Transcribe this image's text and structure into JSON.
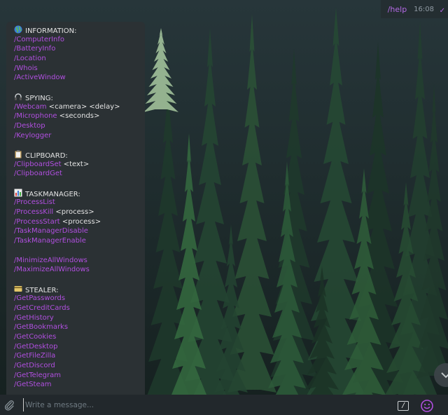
{
  "outgoing": {
    "text": "/help",
    "time": "16:08",
    "check": "✓"
  },
  "bubble": {
    "lines": [
      {
        "t": "h",
        "emoji": "globe-icon",
        "text": "INFORMATION:"
      },
      {
        "t": "c",
        "cmd": "/ComputerInfo",
        "arg": ""
      },
      {
        "t": "c",
        "cmd": "/BatteryInfo",
        "arg": ""
      },
      {
        "t": "c",
        "cmd": "/Location",
        "arg": ""
      },
      {
        "t": "c",
        "cmd": "/Whois",
        "arg": ""
      },
      {
        "t": "c",
        "cmd": "/ActiveWindow",
        "arg": ""
      },
      {
        "t": "g"
      },
      {
        "t": "h",
        "emoji": "headphones-icon",
        "text": "SPYING:"
      },
      {
        "t": "c",
        "cmd": "/Webcam",
        "arg": " <camera> <delay>"
      },
      {
        "t": "c",
        "cmd": "/Microphone",
        "arg": " <seconds>"
      },
      {
        "t": "c",
        "cmd": "/Desktop",
        "arg": ""
      },
      {
        "t": "c",
        "cmd": "/Keylogger",
        "arg": ""
      },
      {
        "t": "g"
      },
      {
        "t": "h",
        "emoji": "clipboard-icon",
        "text": "CLIPBOARD:"
      },
      {
        "t": "c",
        "cmd": "/ClipboardSet",
        "arg": " <text>"
      },
      {
        "t": "c",
        "cmd": "/ClipboardGet",
        "arg": ""
      },
      {
        "t": "g"
      },
      {
        "t": "h",
        "emoji": "bar-chart-icon",
        "text": "TASKMANAGER:"
      },
      {
        "t": "c",
        "cmd": "/ProcessList",
        "arg": ""
      },
      {
        "t": "c",
        "cmd": "/ProcessKill",
        "arg": " <process>"
      },
      {
        "t": "c",
        "cmd": "/ProcessStart",
        "arg": " <process>"
      },
      {
        "t": "c",
        "cmd": "/TaskManagerDisable",
        "arg": ""
      },
      {
        "t": "c",
        "cmd": "/TaskManagerEnable",
        "arg": ""
      },
      {
        "t": "g"
      },
      {
        "t": "c",
        "cmd": "/MinimizeAllWindows",
        "arg": ""
      },
      {
        "t": "c",
        "cmd": "/MaximizeAllWindows",
        "arg": ""
      },
      {
        "t": "g"
      },
      {
        "t": "h",
        "emoji": "credit-card-icon",
        "text": "STEALER:"
      },
      {
        "t": "c",
        "cmd": "/GetPasswords",
        "arg": ""
      },
      {
        "t": "c",
        "cmd": "/GetCreditCards",
        "arg": ""
      },
      {
        "t": "c",
        "cmd": "/GetHistory",
        "arg": ""
      },
      {
        "t": "c",
        "cmd": "/GetBookmarks",
        "arg": ""
      },
      {
        "t": "c",
        "cmd": "/GetCookies",
        "arg": ""
      },
      {
        "t": "c",
        "cmd": "/GetDesktop",
        "arg": ""
      },
      {
        "t": "c",
        "cmd": "/GetFileZilla",
        "arg": ""
      },
      {
        "t": "c",
        "cmd": "/GetDiscord",
        "arg": ""
      },
      {
        "t": "c",
        "cmd": "/GetTelegram",
        "arg": ""
      },
      {
        "t": "c",
        "cmd": "/GetSteam",
        "arg": ""
      }
    ]
  },
  "composer": {
    "placeholder": "Write a message...",
    "commands_glyph": "/"
  },
  "icons": [
    "attach-paperclip-icon",
    "bot-commands-icon",
    "emoji-smile-icon",
    "chevron-down-icon"
  ],
  "colors": {
    "accent": "#b14fe0",
    "bubble": "#2b3134",
    "composer": "#22282c"
  }
}
